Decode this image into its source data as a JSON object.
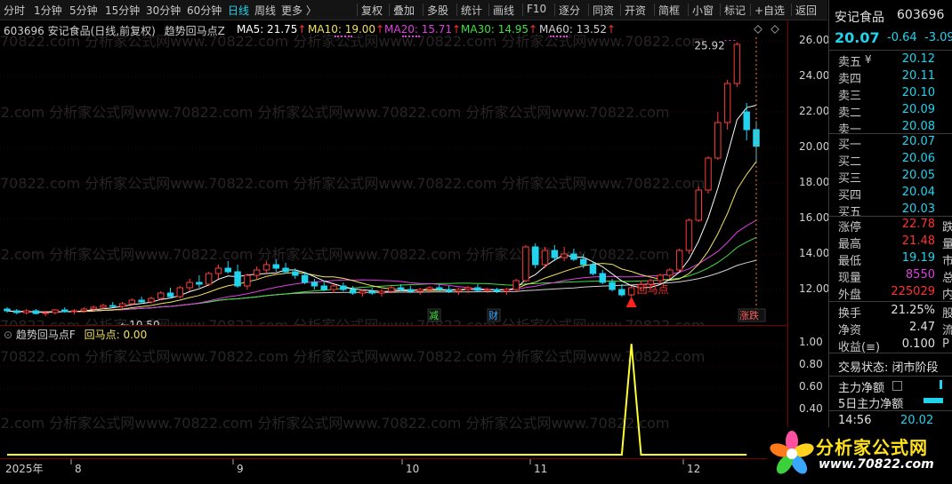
{
  "toolbar": {
    "periods": [
      "分时",
      "1分钟",
      "5分钟",
      "15分钟",
      "30分钟",
      "60分钟",
      "日线",
      "周线",
      "更多 〉"
    ],
    "active_period": "日线",
    "tools": [
      "复权",
      "叠加",
      "多股",
      "统计",
      "画线",
      "F10",
      "逐分",
      "同资",
      "开资",
      "简框",
      "小窗",
      "标记",
      "+自选",
      "返回"
    ]
  },
  "main_header": {
    "stock": "603696 安记食品(日线,前复权)",
    "indicator": "趋势回马点Z",
    "ma": [
      {
        "label": "MA5: 21.75",
        "color": "#ffffff"
      },
      {
        "label": "MA10: 19.00",
        "color": "#f0e060"
      },
      {
        "label": "MA20: 15.71",
        "color": "#e040e0"
      },
      {
        "label": "MA30: 14.95",
        "color": "#40e040"
      },
      {
        "label": "MA60: 13.52",
        "color": "#d0d0d0"
      }
    ],
    "arrow": "↑"
  },
  "sub_header": {
    "indicator": "趋势回马点F",
    "value": "回马点: 0.00"
  },
  "annotations": {
    "high_label": "25.92",
    "low_label": "←10.50",
    "signal_label": "回马点",
    "marker_jian": "减",
    "marker_cai": "财",
    "marker_zhangdie": "涨跌"
  },
  "watermark": "70822.com 分析家公式网www.70822.com 分析家公式网www.70822.com 分析家公式网www.70822.com",
  "bottom_axis": {
    "labels": [
      "2025年",
      "8",
      "9",
      "10",
      "11",
      "12"
    ]
  },
  "chart_data": [
    {
      "type": "candlestick",
      "title": "603696 安记食品(日线,前复权)",
      "y_ticks": [
        "26.00",
        "24.00",
        "22.00",
        "20.00",
        "18.00",
        "16.00",
        "14.00",
        "12.00"
      ],
      "ylim": [
        10.4,
        26.8
      ],
      "candles": [
        {
          "o": 10.9,
          "h": 11.0,
          "l": 10.7,
          "c": 10.8
        },
        {
          "o": 10.8,
          "h": 10.9,
          "l": 10.6,
          "c": 10.7
        },
        {
          "o": 10.7,
          "h": 10.9,
          "l": 10.6,
          "c": 10.8
        },
        {
          "o": 10.8,
          "h": 10.9,
          "l": 10.6,
          "c": 10.65
        },
        {
          "o": 10.65,
          "h": 10.8,
          "l": 10.5,
          "c": 10.7
        },
        {
          "o": 10.7,
          "h": 10.9,
          "l": 10.6,
          "c": 10.85
        },
        {
          "o": 10.85,
          "h": 11.0,
          "l": 10.7,
          "c": 10.75
        },
        {
          "o": 10.75,
          "h": 10.9,
          "l": 10.6,
          "c": 10.8
        },
        {
          "o": 10.8,
          "h": 11.0,
          "l": 10.7,
          "c": 10.9
        },
        {
          "o": 10.9,
          "h": 11.1,
          "l": 10.8,
          "c": 11.0
        },
        {
          "o": 11.0,
          "h": 11.2,
          "l": 10.9,
          "c": 11.1
        },
        {
          "o": 11.1,
          "h": 11.3,
          "l": 11.0,
          "c": 11.05
        },
        {
          "o": 11.05,
          "h": 11.3,
          "l": 10.9,
          "c": 11.2
        },
        {
          "o": 11.2,
          "h": 11.5,
          "l": 11.1,
          "c": 11.4
        },
        {
          "o": 11.4,
          "h": 11.6,
          "l": 11.2,
          "c": 11.3
        },
        {
          "o": 11.3,
          "h": 11.6,
          "l": 11.2,
          "c": 11.5
        },
        {
          "o": 11.5,
          "h": 11.9,
          "l": 11.4,
          "c": 11.8
        },
        {
          "o": 11.8,
          "h": 12.1,
          "l": 11.5,
          "c": 11.6
        },
        {
          "o": 11.6,
          "h": 12.2,
          "l": 11.5,
          "c": 12.1
        },
        {
          "o": 12.1,
          "h": 12.6,
          "l": 11.9,
          "c": 12.4
        },
        {
          "o": 12.4,
          "h": 12.8,
          "l": 12.1,
          "c": 12.3
        },
        {
          "o": 12.3,
          "h": 13.0,
          "l": 12.2,
          "c": 12.9
        },
        {
          "o": 12.9,
          "h": 13.4,
          "l": 12.6,
          "c": 13.2
        },
        {
          "o": 13.2,
          "h": 13.6,
          "l": 12.9,
          "c": 13.0
        },
        {
          "o": 13.0,
          "h": 13.4,
          "l": 12.1,
          "c": 12.2
        },
        {
          "o": 12.2,
          "h": 12.9,
          "l": 12.0,
          "c": 12.8
        },
        {
          "o": 12.8,
          "h": 13.3,
          "l": 12.6,
          "c": 13.1
        },
        {
          "o": 13.1,
          "h": 13.6,
          "l": 12.9,
          "c": 13.4
        },
        {
          "o": 13.4,
          "h": 13.7,
          "l": 13.0,
          "c": 13.2
        },
        {
          "o": 13.2,
          "h": 13.5,
          "l": 12.9,
          "c": 13.0
        },
        {
          "o": 13.0,
          "h": 13.2,
          "l": 12.6,
          "c": 12.8
        },
        {
          "o": 12.8,
          "h": 13.0,
          "l": 12.3,
          "c": 12.4
        },
        {
          "o": 12.4,
          "h": 12.6,
          "l": 12.0,
          "c": 12.2
        },
        {
          "o": 12.2,
          "h": 12.5,
          "l": 11.9,
          "c": 12.0
        },
        {
          "o": 12.0,
          "h": 12.3,
          "l": 11.8,
          "c": 12.2
        },
        {
          "o": 12.2,
          "h": 12.4,
          "l": 11.9,
          "c": 12.0
        },
        {
          "o": 12.0,
          "h": 12.2,
          "l": 11.7,
          "c": 11.8
        },
        {
          "o": 11.8,
          "h": 12.0,
          "l": 11.6,
          "c": 11.9
        },
        {
          "o": 11.9,
          "h": 12.1,
          "l": 11.7,
          "c": 11.8
        },
        {
          "o": 11.8,
          "h": 12.0,
          "l": 11.6,
          "c": 11.9
        },
        {
          "o": 11.9,
          "h": 12.2,
          "l": 11.8,
          "c": 12.1
        },
        {
          "o": 12.1,
          "h": 12.3,
          "l": 11.9,
          "c": 12.0
        },
        {
          "o": 12.0,
          "h": 12.2,
          "l": 11.8,
          "c": 11.9
        },
        {
          "o": 11.9,
          "h": 12.1,
          "l": 11.7,
          "c": 12.0
        },
        {
          "o": 12.0,
          "h": 12.2,
          "l": 11.8,
          "c": 12.1
        },
        {
          "o": 12.1,
          "h": 12.3,
          "l": 11.9,
          "c": 12.0
        },
        {
          "o": 12.0,
          "h": 12.2,
          "l": 11.8,
          "c": 11.9
        },
        {
          "o": 11.9,
          "h": 12.1,
          "l": 11.7,
          "c": 12.0
        },
        {
          "o": 12.0,
          "h": 12.2,
          "l": 11.8,
          "c": 12.1
        },
        {
          "o": 12.1,
          "h": 12.3,
          "l": 11.9,
          "c": 11.95
        },
        {
          "o": 11.95,
          "h": 12.1,
          "l": 11.8,
          "c": 12.0
        },
        {
          "o": 12.0,
          "h": 12.1,
          "l": 11.8,
          "c": 11.9
        },
        {
          "o": 11.9,
          "h": 12.1,
          "l": 11.7,
          "c": 12.0
        },
        {
          "o": 12.0,
          "h": 12.6,
          "l": 11.9,
          "c": 12.5
        },
        {
          "o": 12.5,
          "h": 14.5,
          "l": 12.4,
          "c": 14.4
        },
        {
          "o": 14.4,
          "h": 14.6,
          "l": 13.2,
          "c": 13.4
        },
        {
          "o": 13.4,
          "h": 14.4,
          "l": 13.2,
          "c": 14.2
        },
        {
          "o": 14.2,
          "h": 14.5,
          "l": 13.6,
          "c": 13.8
        },
        {
          "o": 13.8,
          "h": 14.4,
          "l": 13.6,
          "c": 14.0
        },
        {
          "o": 14.0,
          "h": 14.3,
          "l": 13.6,
          "c": 13.7
        },
        {
          "o": 13.7,
          "h": 14.0,
          "l": 13.2,
          "c": 13.4
        },
        {
          "o": 13.4,
          "h": 13.6,
          "l": 12.8,
          "c": 12.9
        },
        {
          "o": 12.9,
          "h": 13.1,
          "l": 12.3,
          "c": 12.4
        },
        {
          "o": 12.4,
          "h": 12.6,
          "l": 11.9,
          "c": 12.0
        },
        {
          "o": 12.0,
          "h": 12.3,
          "l": 11.6,
          "c": 11.7
        },
        {
          "o": 11.7,
          "h": 12.2,
          "l": 11.6,
          "c": 12.1
        },
        {
          "o": 12.1,
          "h": 12.5,
          "l": 12.0,
          "c": 12.3
        },
        {
          "o": 12.3,
          "h": 12.6,
          "l": 12.1,
          "c": 12.5
        },
        {
          "o": 12.5,
          "h": 12.9,
          "l": 12.3,
          "c": 12.8
        },
        {
          "o": 12.8,
          "h": 13.2,
          "l": 12.6,
          "c": 13.1
        },
        {
          "o": 13.1,
          "h": 14.3,
          "l": 13.0,
          "c": 14.2
        },
        {
          "o": 14.2,
          "h": 16.0,
          "l": 14.0,
          "c": 15.9
        },
        {
          "o": 15.9,
          "h": 17.8,
          "l": 15.8,
          "c": 17.6
        },
        {
          "o": 17.6,
          "h": 19.5,
          "l": 17.4,
          "c": 19.4
        },
        {
          "o": 19.4,
          "h": 22.0,
          "l": 19.3,
          "c": 21.4
        },
        {
          "o": 21.4,
          "h": 23.8,
          "l": 21.0,
          "c": 23.6
        },
        {
          "o": 23.6,
          "h": 25.92,
          "l": 23.4,
          "c": 25.8
        },
        {
          "o": 22.0,
          "h": 22.5,
          "l": 20.4,
          "c": 21.0
        },
        {
          "o": 21.0,
          "h": 21.48,
          "l": 19.19,
          "c": 20.07
        }
      ],
      "ma_colors": {
        "ma5": "#ffffff",
        "ma10": "#f0e060",
        "ma20": "#e040e0",
        "ma30": "#40e040",
        "ma60": "#d0d0d0"
      }
    },
    {
      "type": "line",
      "title": "趋势回马点F",
      "series": [
        {
          "name": "回马点",
          "values": [
            0,
            0,
            0,
            0,
            0,
            0,
            0,
            0,
            0,
            0,
            0,
            0,
            0,
            0,
            0,
            0,
            0,
            0,
            0,
            0,
            0,
            0,
            0,
            0,
            0,
            0,
            0,
            0,
            0,
            0,
            0,
            0,
            0,
            0,
            0,
            0,
            0,
            0,
            0,
            0,
            0,
            0,
            0,
            0,
            0,
            0,
            0,
            0,
            0,
            0,
            0,
            0,
            0,
            0,
            0,
            0,
            0,
            0,
            0,
            0,
            0,
            0,
            0,
            0,
            0,
            1,
            0,
            0,
            0,
            0,
            0,
            0,
            0,
            0,
            0,
            0,
            0,
            0
          ]
        }
      ],
      "y_ticks": [
        "1.00",
        "0.80",
        "0.60",
        "0.40"
      ],
      "ylim": [
        0,
        1.05
      ]
    }
  ],
  "panel": {
    "name": "安记食品",
    "code": "603696",
    "price": "20.07",
    "change": "-0.64",
    "pct": "-3.09",
    "sell": [
      {
        "l": "卖五",
        "v": "20.12",
        "e": "¥"
      },
      {
        "l": "卖四",
        "v": "20.11"
      },
      {
        "l": "卖三",
        "v": "20.10"
      },
      {
        "l": "卖二",
        "v": "20.09"
      },
      {
        "l": "卖一",
        "v": "20.08"
      }
    ],
    "buy": [
      {
        "l": "买一",
        "v": "20.07"
      },
      {
        "l": "买二",
        "v": "20.06"
      },
      {
        "l": "买三",
        "v": "20.05"
      },
      {
        "l": "买四",
        "v": "20.04"
      },
      {
        "l": "买五",
        "v": "20.03"
      }
    ],
    "stats": [
      {
        "l": "涨停",
        "v": "22.78",
        "c": "#ff3030",
        "x": "跌"
      },
      {
        "l": "最高",
        "v": "21.48",
        "c": "#ff3030",
        "x": "量"
      },
      {
        "l": "最低",
        "v": "19.19",
        "c": "#22d3ee",
        "x": "市"
      },
      {
        "l": "现量",
        "v": "8550",
        "c": "#e040e0",
        "x": "总"
      },
      {
        "l": "外盘",
        "v": "225029",
        "c": "#ff3030",
        "x": "内"
      }
    ],
    "stats2": [
      {
        "l": "换手",
        "v": "21.25%",
        "x": "股"
      },
      {
        "l": "净资",
        "v": "2.47",
        "x": "流"
      },
      {
        "l": "收益(≡)",
        "v": "0.100",
        "x": "P"
      }
    ],
    "status": "交易状态: 闭市阶段",
    "flow1": "主力净额",
    "flow2": "5日主力净额",
    "tick_time": "14:56",
    "tick_price": "20.02"
  },
  "logo": {
    "text": "分析家公式网",
    "url": "www.70822.com"
  }
}
